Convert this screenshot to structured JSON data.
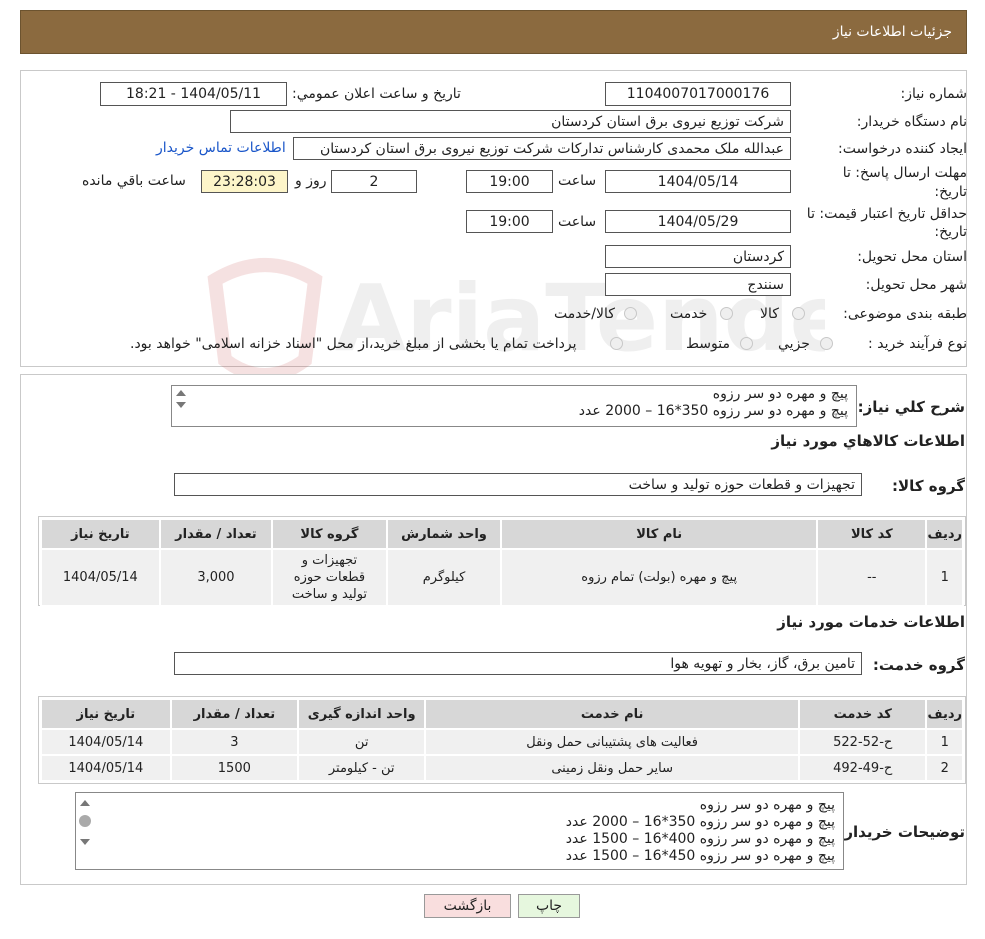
{
  "header": {
    "title": "جزئیات اطلاعات نیاز"
  },
  "form": {
    "need_number_label": "شماره نیاز:",
    "need_number": "1104007017000176",
    "announce_label": "تاريخ و ساعت اعلان عمومي:",
    "announce_value": "1404/05/11 - 18:21",
    "buyer_org_label": "نام دستگاه خريدار:",
    "buyer_org": "شرکت توزیع نیروی برق استان کردستان",
    "creator_label": "ايجاد کننده درخواست:",
    "creator": "عبدالله ملک محمدی کارشناس تداركات شرکت توزیع نیروی برق استان کردستان",
    "contact_link": "اطلاعات تماس خريدار",
    "deadline_label_1": "مهلت ارسال پاسخ: تا",
    "deadline_label_2": "تاريخ:",
    "deadline_date": "1404/05/14",
    "hour_label": "ساعت",
    "deadline_time": "19:00",
    "days_value": "2",
    "days_label": "روز و",
    "remaining_time": "23:28:03",
    "remaining_label": "ساعت باقي مانده",
    "validity_label_1": "حداقل تاريخ اعتبار قيمت: تا",
    "validity_label_2": "تاريخ:",
    "validity_date": "1404/05/29",
    "validity_hour_label": "ساعت",
    "validity_time": "19:00",
    "province_label": "استان محل تحويل:",
    "province": "کردستان",
    "city_label": "شهر محل تحويل:",
    "city": "سنندج",
    "category_label": "طبقه بندی موضوعی:",
    "category_options": [
      "کالا",
      "خدمت",
      "کالا/خدمت"
    ],
    "process_label": "نوع فرآيند خريد :",
    "process_options": [
      "جزيي",
      "متوسط"
    ],
    "process_note": "پرداخت تمام يا بخشی از مبلغ خريد،از محل \"اسناد خزانه اسلامی\" خواهد بود."
  },
  "description": {
    "label": "شرح کلي نياز:",
    "lines": [
      "پیچ و مهره دو سر رزوه",
      "پیچ و مهره دو سر رزوه 350*16 – 2000 عدد"
    ]
  },
  "goods": {
    "title": "اطلاعات کالاهاي مورد نياز",
    "group_label": "گروه کالا:",
    "group_value": "تجهيزات و قطعات حوزه توليد و ساخت",
    "headers": [
      "رديف",
      "کد کالا",
      "نام کالا",
      "واحد شمارش",
      "گروه کالا",
      "تعداد / مقدار",
      "تاريخ نياز"
    ],
    "rows": [
      [
        "1",
        "--",
        "پیچ و مهره (بولت) تمام رزوه",
        "کيلوگرم",
        "تجهيزات و قطعات حوزه توليد و ساخت",
        "3,000",
        "1404/05/14"
      ]
    ]
  },
  "services": {
    "title": "اطلاعات خدمات مورد نياز",
    "group_label": "گروه خدمت:",
    "group_value": "تامين برق، گاز، بخار و تهويه هوا",
    "headers": [
      "رديف",
      "کد خدمت",
      "نام خدمت",
      "واحد اندازه گيری",
      "تعداد / مقدار",
      "تاريخ نياز"
    ],
    "rows": [
      [
        "1",
        "ح-52-522",
        "فعاليت های پشتيبانی حمل ونقل",
        "تن",
        "3",
        "1404/05/14"
      ],
      [
        "2",
        "ح-49-492",
        "ساير حمل ونقل زمينی",
        "تن - کيلومتر",
        "1500",
        "1404/05/14"
      ]
    ]
  },
  "buyer_notes": {
    "label": "توضيحات خريدار:",
    "lines": [
      "پیچ و مهره دو سر رزوه",
      "پیچ و مهره دو سر رزوه 350*16 – 2000 عدد",
      "پیچ و مهره دو سر رزوه 400*16 – 1500 عدد",
      "پیچ و مهره دو سر رزوه 450*16 – 1500 عدد"
    ]
  },
  "buttons": {
    "print": "چاپ",
    "back": "بازگشت"
  },
  "watermark": {
    "text": "AriaTender.neT"
  },
  "colors": {
    "header_bg": "#8b6a3f",
    "yellow_box": "#fdf5c9",
    "link": "#1a56c9",
    "back_btn": "#f9dede",
    "print_btn": "#e6f7de"
  }
}
